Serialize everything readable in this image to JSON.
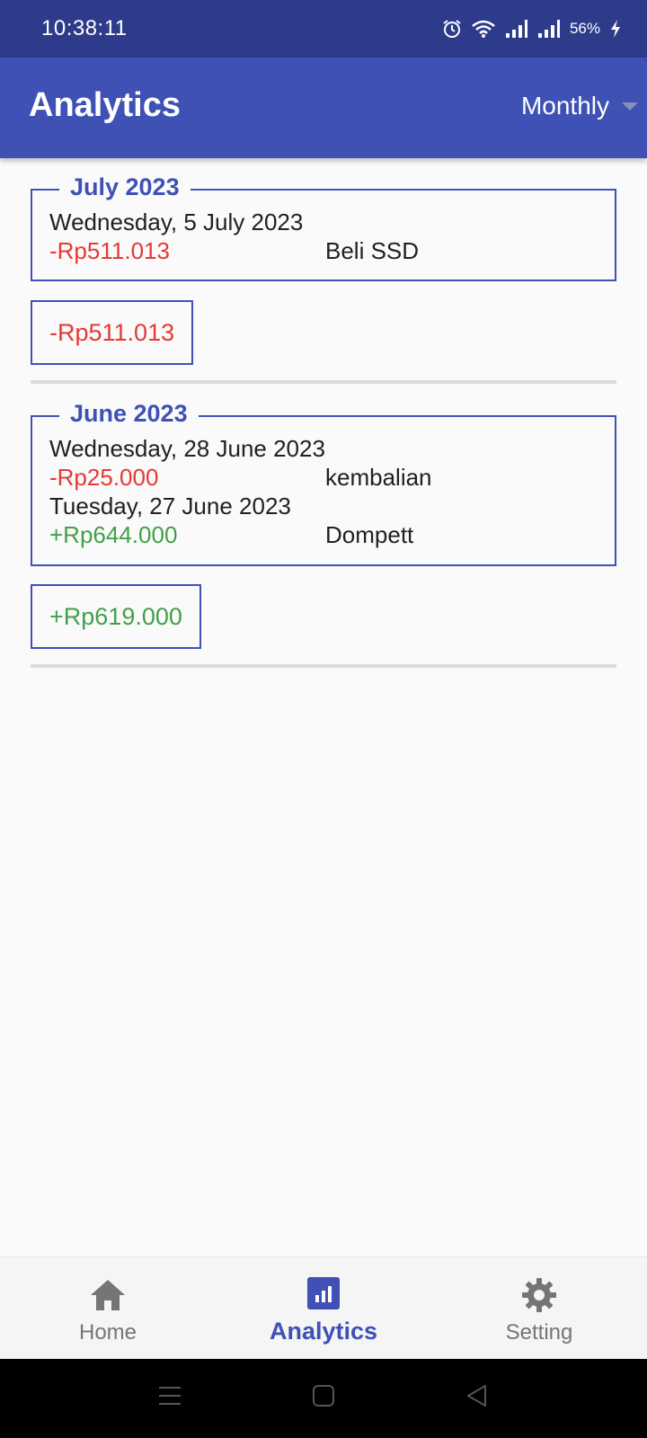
{
  "status_bar": {
    "time": "10:38:11",
    "battery": "56%",
    "icons": [
      "alarm-icon",
      "wifi-icon",
      "signal-icon",
      "signal-icon",
      "charging-icon"
    ]
  },
  "app_bar": {
    "title": "Analytics",
    "period_selected": "Monthly"
  },
  "months": [
    {
      "label": "July 2023",
      "transactions": [
        {
          "date": "Wednesday, 5 July 2023",
          "amount": "-Rp511.013",
          "note": "Beli SSD",
          "type": "expense"
        }
      ],
      "total": "-Rp511.013",
      "total_type": "expense"
    },
    {
      "label": "June 2023",
      "transactions": [
        {
          "date": "Wednesday, 28 June 2023",
          "amount": "-Rp25.000",
          "note": "kembalian",
          "type": "expense"
        },
        {
          "date": "Tuesday, 27 June 2023",
          "amount": "+Rp644.000",
          "note": "Dompett",
          "type": "income"
        }
      ],
      "total": "+Rp619.000",
      "total_type": "income"
    }
  ],
  "bottom_nav": {
    "items": [
      {
        "label": "Home",
        "icon": "home-icon",
        "active": false
      },
      {
        "label": "Analytics",
        "icon": "analytics-icon",
        "active": true
      },
      {
        "label": "Setting",
        "icon": "gear-icon",
        "active": false
      }
    ]
  },
  "colors": {
    "primary": "#3f51b5",
    "primary_dark": "#2e3b8a",
    "expense": "#e53935",
    "income": "#43a047"
  }
}
